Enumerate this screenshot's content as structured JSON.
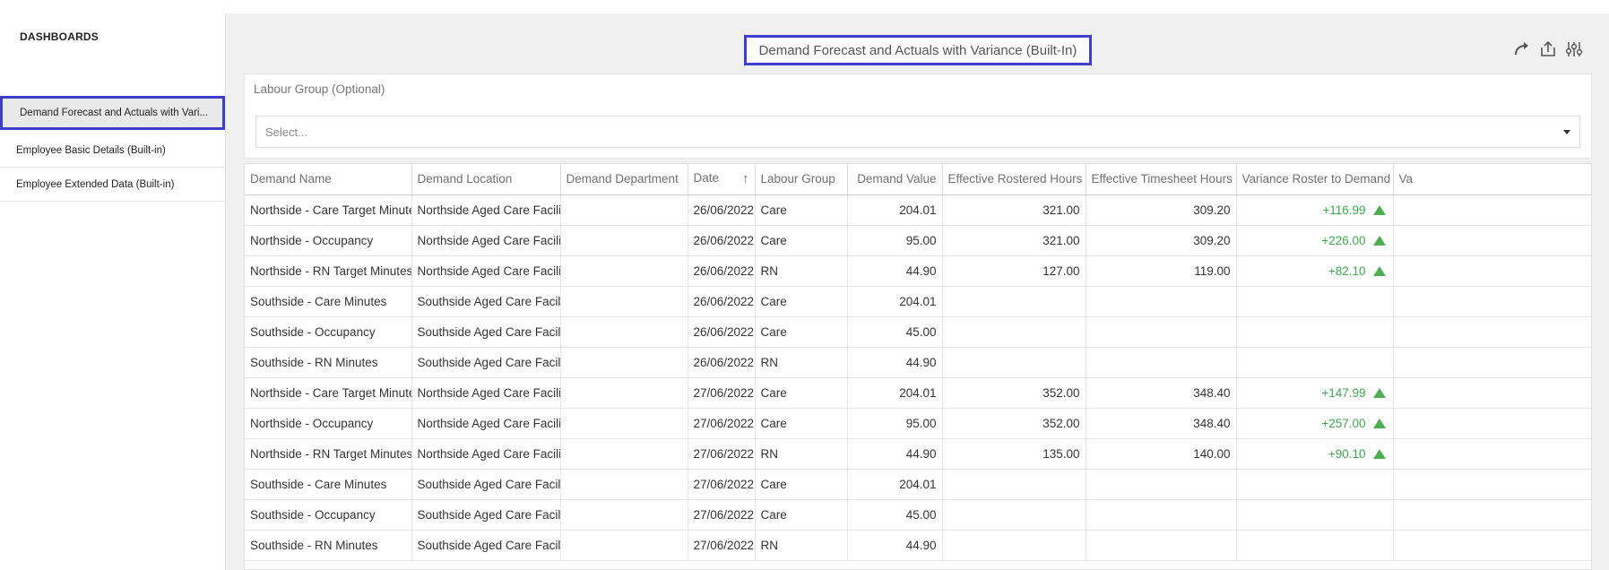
{
  "sidebar": {
    "title": "DASHBOARDS",
    "items": [
      {
        "label": "Demand Forecast and Actuals with Vari..."
      },
      {
        "label": "Employee Basic Details (Built-in)"
      },
      {
        "label": "Employee Extended Data (Built-in)"
      }
    ]
  },
  "page": {
    "title": "Demand Forecast and Actuals with Variance (Built-In)"
  },
  "toolbar": {
    "icons": [
      "refresh-icon",
      "share-icon",
      "settings-sliders-icon"
    ]
  },
  "filter": {
    "label": "Labour Group (Optional)",
    "placeholder": "Select..."
  },
  "table": {
    "columns": [
      "Demand Name",
      "Demand Location",
      "Demand Department",
      "Date",
      "Labour Group",
      "Demand Value",
      "Effective Rostered Hours",
      "Effective Timesheet Hours",
      "Variance Roster to Demand",
      "Va"
    ],
    "sort": {
      "column": "Date",
      "direction": "ascending"
    },
    "rows": [
      {
        "name": "Northside - Care Target Minutes",
        "location": "Northside Aged Care Facility",
        "department": "",
        "date": "26/06/2022",
        "group": "Care",
        "value": "204.01",
        "rostered": "321.00",
        "timesheet": "309.20",
        "variance": "+116.99",
        "up": true
      },
      {
        "name": "Northside - Occupancy",
        "location": "Northside Aged Care Facility",
        "department": "",
        "date": "26/06/2022",
        "group": "Care",
        "value": "95.00",
        "rostered": "321.00",
        "timesheet": "309.20",
        "variance": "+226.00",
        "up": true
      },
      {
        "name": "Northside - RN Target Minutes",
        "location": "Northside Aged Care Facility",
        "department": "",
        "date": "26/06/2022",
        "group": "RN",
        "value": "44.90",
        "rostered": "127.00",
        "timesheet": "119.00",
        "variance": "+82.10",
        "up": true
      },
      {
        "name": "Southside - Care Minutes",
        "location": "Southside Aged Care Facility",
        "department": "",
        "date": "26/06/2022",
        "group": "Care",
        "value": "204.01",
        "rostered": "",
        "timesheet": "",
        "variance": "",
        "up": false
      },
      {
        "name": "Southside - Occupancy",
        "location": "Southside Aged Care Facility",
        "department": "",
        "date": "26/06/2022",
        "group": "Care",
        "value": "45.00",
        "rostered": "",
        "timesheet": "",
        "variance": "",
        "up": false
      },
      {
        "name": "Southside - RN Minutes",
        "location": "Southside Aged Care Facility",
        "department": "",
        "date": "26/06/2022",
        "group": "RN",
        "value": "44.90",
        "rostered": "",
        "timesheet": "",
        "variance": "",
        "up": false
      },
      {
        "name": "Northside - Care Target Minutes",
        "location": "Northside Aged Care Facility",
        "department": "",
        "date": "27/06/2022",
        "group": "Care",
        "value": "204.01",
        "rostered": "352.00",
        "timesheet": "348.40",
        "variance": "+147.99",
        "up": true
      },
      {
        "name": "Northside - Occupancy",
        "location": "Northside Aged Care Facility",
        "department": "",
        "date": "27/06/2022",
        "group": "Care",
        "value": "95.00",
        "rostered": "352.00",
        "timesheet": "348.40",
        "variance": "+257.00",
        "up": true
      },
      {
        "name": "Northside - RN Target Minutes",
        "location": "Northside Aged Care Facility",
        "department": "",
        "date": "27/06/2022",
        "group": "RN",
        "value": "44.90",
        "rostered": "135.00",
        "timesheet": "140.00",
        "variance": "+90.10",
        "up": true
      },
      {
        "name": "Southside - Care Minutes",
        "location": "Southside Aged Care Facility",
        "department": "",
        "date": "27/06/2022",
        "group": "Care",
        "value": "204.01",
        "rostered": "",
        "timesheet": "",
        "variance": "",
        "up": false
      },
      {
        "name": "Southside - Occupancy",
        "location": "Southside Aged Care Facility",
        "department": "",
        "date": "27/06/2022",
        "group": "Care",
        "value": "45.00",
        "rostered": "",
        "timesheet": "",
        "variance": "",
        "up": false
      },
      {
        "name": "Southside - RN Minutes",
        "location": "Southside Aged Care Facility",
        "department": "",
        "date": "27/06/2022",
        "group": "RN",
        "value": "44.90",
        "rostered": "",
        "timesheet": "",
        "variance": "",
        "up": false
      }
    ]
  },
  "colors": {
    "highlight": "#3c3fc9",
    "positive": "#3ea84e",
    "positive_arrow": "#4caf50",
    "content_bg": "#f0f0f0"
  }
}
